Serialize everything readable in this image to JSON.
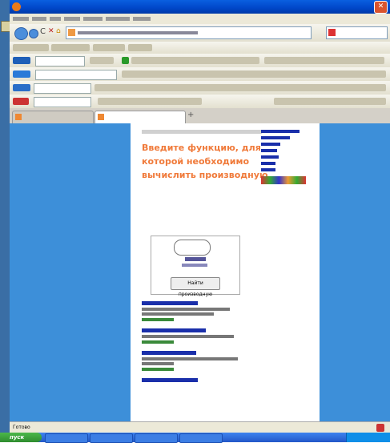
{
  "window": {
    "title": ""
  },
  "tabs": [
    {
      "label": ""
    },
    {
      "label": ""
    }
  ],
  "content": {
    "headline": "Введите функцию, для которой необходимо вычислить производную",
    "find_button": "Найти производную"
  },
  "status": {
    "text": "Готово"
  },
  "taskbar": {
    "start_label": "пуск"
  },
  "colors": {
    "content_bg": "#3d8fd9",
    "headline": "#f07a3a",
    "titlebar": "#0046c8"
  }
}
